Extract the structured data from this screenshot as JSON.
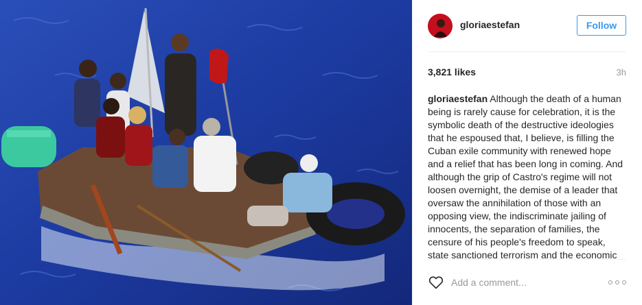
{
  "header": {
    "username": "gloriaestefan",
    "follow_label": "Follow",
    "avatar_icon": "profile-avatar"
  },
  "meta": {
    "likes": "3,821 likes",
    "time_ago": "3h"
  },
  "caption": {
    "author": "gloriaestefan",
    "text": "Although the death of a human being is rarely cause for celebration, it is the symbolic death of the destructive ideologies that he espoused that, I believe, is filling the Cuban exile community with renewed hope and a relief that has been long in coming. And although the grip of Castro's regime will not loosen overnight, the demise of a leader that oversaw the annihilation of those with an opposing view, the indiscriminate jailing of innocents, the separation of families, the censure of his people's freedom to speak, state sanctioned terrorism and the economic"
  },
  "footer": {
    "comment_placeholder": "Add a comment...",
    "like_icon": "heart-outline-icon",
    "more_icon": "more-options-icon"
  },
  "colors": {
    "accent": "#3897f0",
    "muted": "#999999",
    "text": "#262626",
    "divider": "#efefef",
    "sea": "#1c3fa8"
  }
}
